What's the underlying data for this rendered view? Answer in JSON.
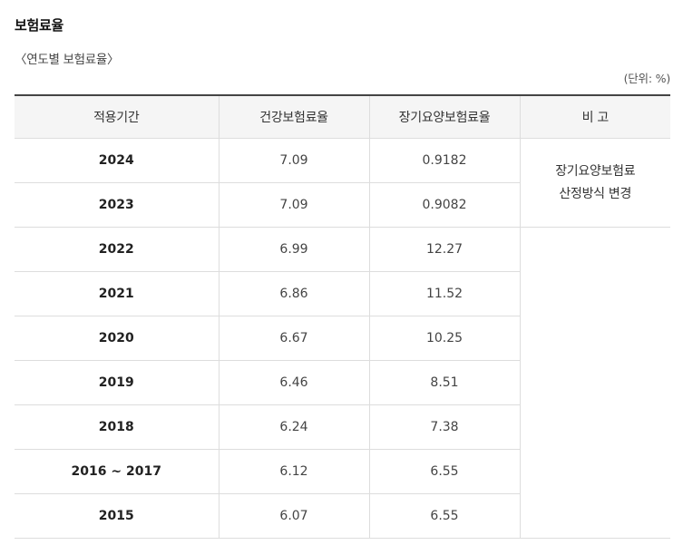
{
  "section": {
    "title": "보험료율",
    "caption": "〈연도별 보험료율〉",
    "unit": "(단위: %)"
  },
  "table": {
    "headers": [
      "적용기간",
      "건강보험료율",
      "장기요양보험료율",
      "비 고"
    ],
    "rows": [
      {
        "period": "2024",
        "health": "7.09",
        "ltc": "0.9182"
      },
      {
        "period": "2023",
        "health": "7.09",
        "ltc": "0.9082"
      },
      {
        "period": "2022",
        "health": "6.99",
        "ltc": "12.27"
      },
      {
        "period": "2021",
        "health": "6.86",
        "ltc": "11.52"
      },
      {
        "period": "2020",
        "health": "6.67",
        "ltc": "10.25"
      },
      {
        "period": "2019",
        "health": "6.46",
        "ltc": "8.51"
      },
      {
        "period": "2018",
        "health": "6.24",
        "ltc": "7.38"
      },
      {
        "period": "2016 ~ 2017",
        "health": "6.12",
        "ltc": "6.55"
      },
      {
        "period": "2015",
        "health": "6.07",
        "ltc": "6.55"
      }
    ],
    "note": {
      "line1": "장기요양보험료",
      "line2": "산정방식 변경"
    }
  }
}
